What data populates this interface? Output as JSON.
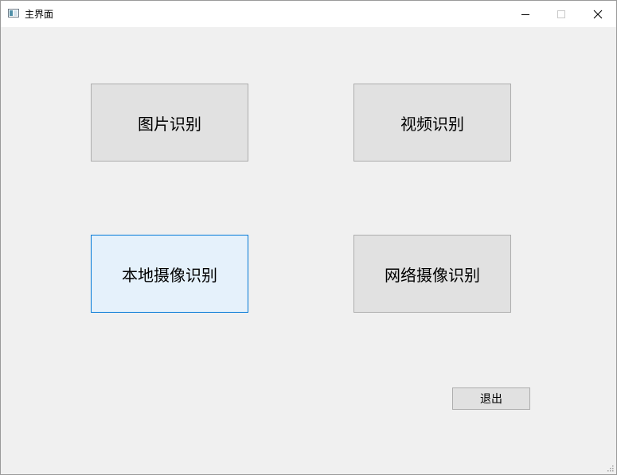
{
  "window": {
    "title": "主界面"
  },
  "caption_buttons": {
    "minimize_icon": "minimize-icon",
    "maximize_icon": "maximize-icon",
    "close_icon": "close-icon"
  },
  "main": {
    "image_recognition_label": "图片识别",
    "video_recognition_label": "视频识别",
    "local_camera_recognition_label": "本地摄像识别",
    "network_camera_recognition_label": "网络摄像识别",
    "exit_label": "退出",
    "focused_button": "本地摄像识别"
  },
  "colors": {
    "window_background": "#f0f0f0",
    "titlebar_background": "#ffffff",
    "button_background": "#e1e1e1",
    "button_border": "#adadad",
    "focused_button_background": "#e5f1fb",
    "focused_button_border": "#0078d7"
  }
}
